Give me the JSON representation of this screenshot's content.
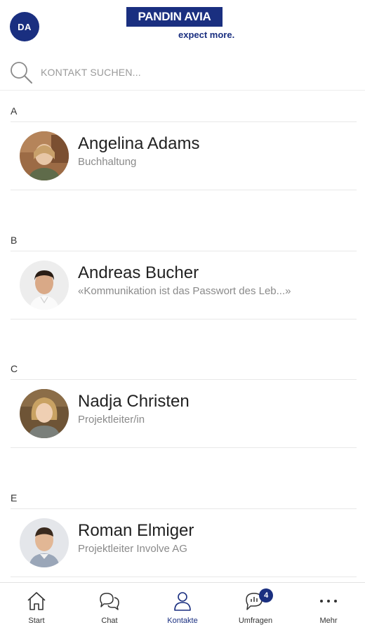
{
  "header": {
    "user_initials": "DA",
    "logo_text": "PANDIN AVIA",
    "logo_tagline": "expect more."
  },
  "search": {
    "placeholder": "KONTAKT SUCHEN...",
    "icon": "search-icon"
  },
  "sections": [
    {
      "letter": "A",
      "contacts": [
        {
          "name": "Angelina Adams",
          "subtitle": "Buchhaltung",
          "photo": "avatar-photo"
        }
      ]
    },
    {
      "letter": "B",
      "contacts": [
        {
          "name": "Andreas Bucher",
          "subtitle": "«Kommunikation ist das Passwort des Leb...»",
          "photo": "avatar-photo"
        }
      ]
    },
    {
      "letter": "C",
      "contacts": [
        {
          "name": "Nadja Christen",
          "subtitle": "Projektleiter/in",
          "photo": "avatar-photo"
        }
      ]
    },
    {
      "letter": "E",
      "contacts": [
        {
          "name": "Roman Elmiger",
          "subtitle": "Projektleiter Involve AG",
          "photo": "avatar-photo"
        }
      ]
    }
  ],
  "nav": {
    "items": [
      {
        "label": "Start",
        "icon": "home-icon"
      },
      {
        "label": "Chat",
        "icon": "chat-icon"
      },
      {
        "label": "Kontakte",
        "icon": "contacts-icon",
        "active": true
      },
      {
        "label": "Umfragen",
        "icon": "survey-icon",
        "badge": "4"
      },
      {
        "label": "Mehr",
        "icon": "more-icon"
      }
    ]
  },
  "colors": {
    "brand": "#1a2f80",
    "divider": "#e8e8e8",
    "subtitle": "#8a8a8a"
  }
}
